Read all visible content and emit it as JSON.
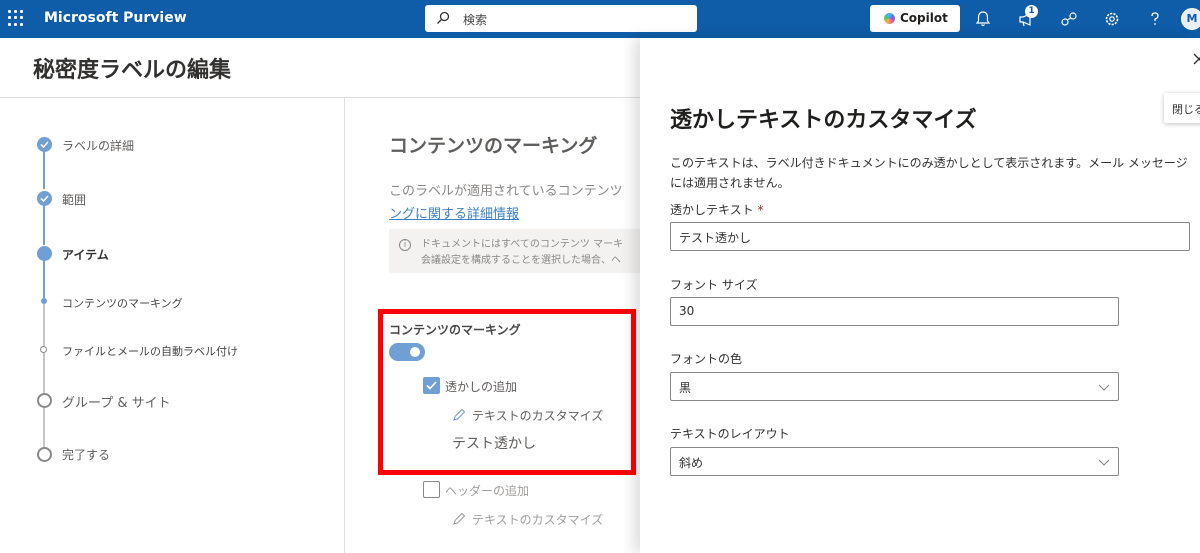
{
  "topbar": {
    "brand": "Microsoft Purview",
    "search_placeholder": "検索",
    "copilot_label": "Copilot",
    "notification_count": "1",
    "avatar_initial": "M"
  },
  "page": {
    "title": "秘密度ラベルの編集"
  },
  "steps": [
    {
      "label": "ラベルの詳細",
      "state": "done"
    },
    {
      "label": "範囲",
      "state": "done"
    },
    {
      "label": "アイテム",
      "state": "current"
    },
    {
      "label": "コンテンツのマーキング",
      "state": "sub-current"
    },
    {
      "label": "ファイルとメールの自動ラベル付け",
      "state": "sub"
    },
    {
      "label": "グループ & サイト",
      "state": "todo"
    },
    {
      "label": "完了する",
      "state": "todo"
    }
  ],
  "content": {
    "title": "コンテンツのマーキング",
    "description": "このラベルが適用されているコンテンツ",
    "link": "ングに関する詳細情報",
    "info_line1": "ドキュメントにはすべてのコンテンツ マーキ",
    "info_line2": "会議設定を構成することを選択した場合、ヘ",
    "marking_label": "コンテンツのマーキング",
    "watermark": {
      "checkbox_label": "透かしの追加",
      "customize_link": "テキストのカスタマイズ",
      "text": "テスト透かし"
    },
    "header": {
      "checkbox_label": "ヘッダーの追加",
      "customize_link": "テキストのカスタマイズ"
    }
  },
  "panel": {
    "close_tooltip": "閉じる",
    "title": "透かしテキストのカスタマイズ",
    "description": "このテキストは、ラベル付きドキュメントにのみ透かしとして表示されます。メール メッセージには適用されません。",
    "text_label": "透かしテキスト",
    "required_mark": "*",
    "text_value": "テスト透かし",
    "font_size_label": "フォント サイズ",
    "font_size_value": "30",
    "font_color_label": "フォントの色",
    "font_color_value": "黒",
    "layout_label": "テキストのレイアウト",
    "layout_value": "斜め"
  },
  "colors": {
    "topbar": "#0f5ca8",
    "accent": "#6f9fd3",
    "highlight": "#ff0000"
  }
}
